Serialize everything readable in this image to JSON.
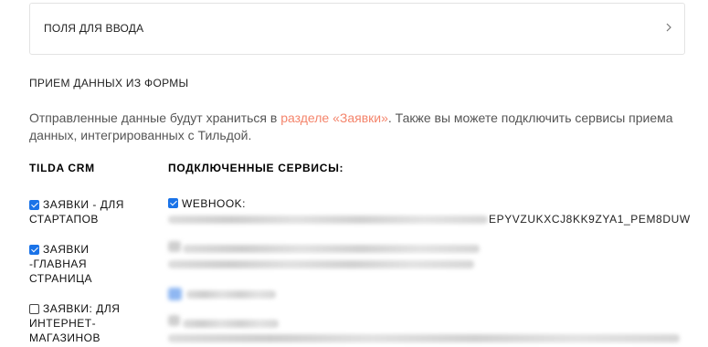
{
  "fields_section": {
    "title": "ПОЛЯ ДЛЯ ВВОДА"
  },
  "receive_section": {
    "title": "ПРИЕМ ДАННЫХ ИЗ ФОРМЫ",
    "description_before": "Отправленные данные будут храниться в ",
    "description_link": "разделе «Заявки»",
    "description_after": ". Также вы можете подключить сервисы приема данных, интегрированных с Тильдой."
  },
  "crm": {
    "heading": "TILDA CRM",
    "items": [
      {
        "label": "ЗАЯВКИ - ДЛЯ СТАРТАПОВ",
        "checked": true
      },
      {
        "label": "ЗАЯВКИ -ГЛАВНАЯ СТРАНИЦА",
        "checked": true
      },
      {
        "label": "ЗАЯВКИ: ДЛЯ ИНТЕРНЕТ-МАГАЗИНОВ",
        "checked": false
      }
    ]
  },
  "services": {
    "heading": "ПОДКЛЮЧЕННЫЕ СЕРВИСЫ:",
    "webhook": {
      "label": "WEBHOOK:",
      "checked": true,
      "url_visible_part": "EPYVZUKXCJ8KK9ZYA1_PEM8DUW"
    }
  },
  "colors": {
    "accent_link": "#f4846b",
    "checkbox_checked": "#1a73e8",
    "border": "#e3e3e3"
  },
  "icons": {
    "chevron": "chevron-right-icon"
  }
}
